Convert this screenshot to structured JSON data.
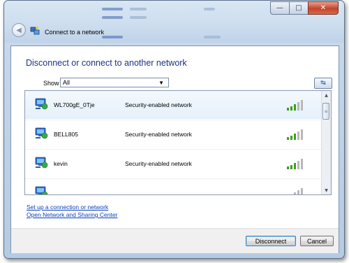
{
  "window": {
    "title": "Connect to a network",
    "minimize_glyph": "—",
    "maximize_glyph": "□",
    "close_glyph": "✕"
  },
  "nav": {
    "back_icon": "back-arrow-icon",
    "back_glyph": "◀"
  },
  "main": {
    "heading": "Disconnect or connect to another network",
    "show_label": "Show",
    "show_value": "All",
    "refresh_icon": "refresh-icon",
    "refresh_glyph": "↹"
  },
  "networks": [
    {
      "name": "WL700gE_0Tje",
      "security": "Security-enabled network",
      "selected": true
    },
    {
      "name": "BELL805",
      "security": "Security-enabled network",
      "selected": false
    },
    {
      "name": "kevin",
      "security": "Security-enabled network",
      "selected": false
    },
    {
      "name": "",
      "security": "",
      "selected": false
    }
  ],
  "links": {
    "setup": "Set up a connection or network",
    "center": "Open Network and Sharing Center"
  },
  "buttons": {
    "disconnect": "Disconnect",
    "cancel": "Cancel"
  },
  "colors": {
    "heading": "#1e3287",
    "link": "#0a3fbd",
    "signal_green": "#3aa11a",
    "signal_gray": "#b8b8b8"
  }
}
